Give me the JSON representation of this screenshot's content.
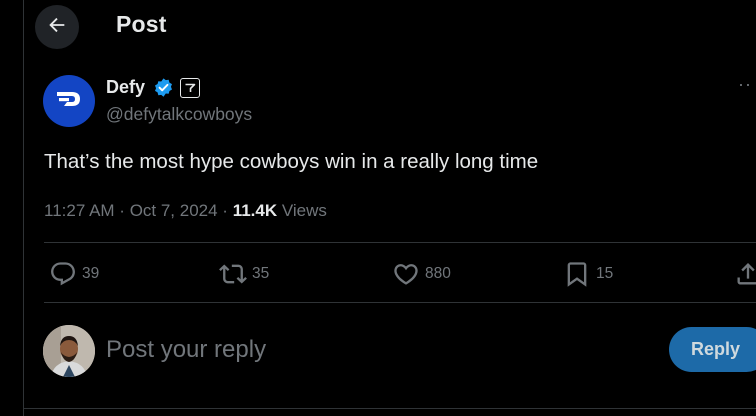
{
  "header": {
    "title": "Post",
    "back_icon": "arrow-left-icon"
  },
  "author": {
    "name": "Defy",
    "handle": "@defytalkcowboys",
    "avatar_icon": "defy-logo-icon",
    "verified_icon": "verified-badge-icon",
    "affiliate_icon": "affiliate-badge-icon",
    "avatar_color": "#1345c4",
    "verified_color": "#1d9bf0"
  },
  "post": {
    "text": "That’s the most hype cowboys win in a really long time",
    "time": "11:27 AM",
    "separator": " · ",
    "date": "Oct 7, 2024",
    "views_count": "11.4K",
    "views_label": " Views"
  },
  "actions": {
    "replies": {
      "icon": "reply-icon",
      "count": "39"
    },
    "reposts": {
      "icon": "repost-icon",
      "count": "35"
    },
    "likes": {
      "icon": "heart-icon",
      "count": "880"
    },
    "bookmarks": {
      "icon": "bookmark-icon",
      "count": "15"
    },
    "share": {
      "icon": "share-icon"
    }
  },
  "composer": {
    "placeholder": "Post your reply",
    "button_label": "Reply",
    "button_color": "#1d6aa8"
  },
  "more_icon": "more-horizontal-icon"
}
